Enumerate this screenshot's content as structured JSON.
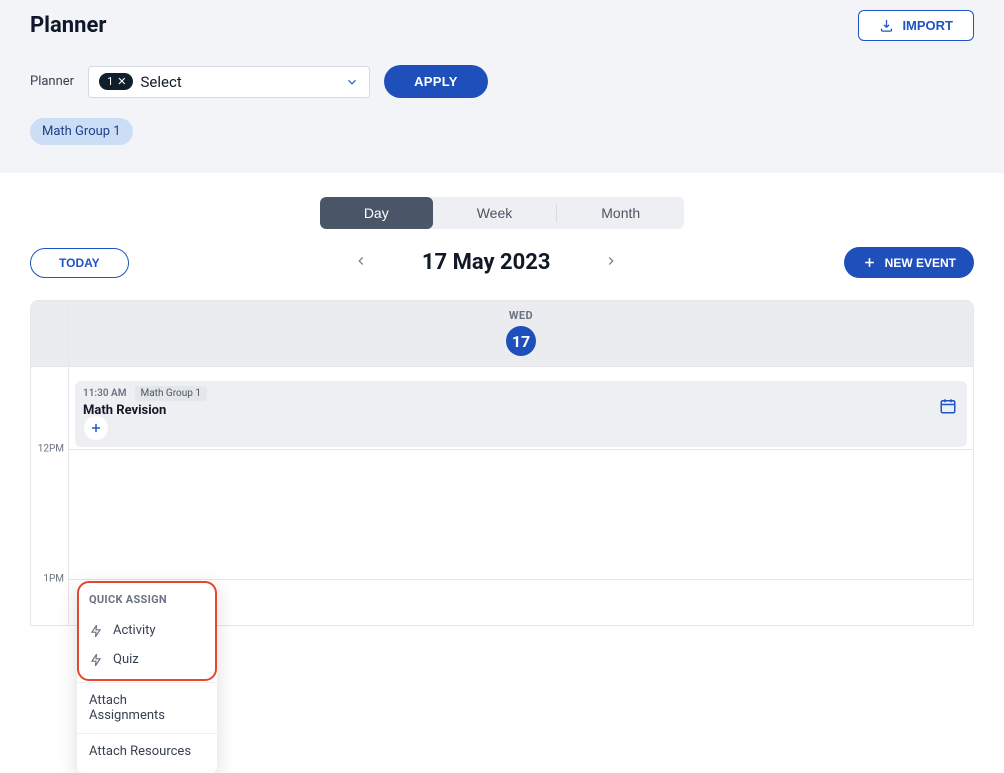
{
  "header": {
    "title": "Planner",
    "import_label": "IMPORT",
    "filter_label": "Planner",
    "select_count": "1",
    "select_placeholder": "Select",
    "apply_label": "APPLY"
  },
  "chips": [
    {
      "label": "Math Group 1"
    }
  ],
  "view_toggle": {
    "day": "Day",
    "week": "Week",
    "month": "Month"
  },
  "nav": {
    "today": "TODAY",
    "date": "17 May 2023",
    "new_event": "NEW EVENT"
  },
  "calendar": {
    "dow": "WED",
    "daynum": "17",
    "times": {
      "t12": "12PM",
      "t1": "1PM"
    },
    "event": {
      "time": "11:30 AM",
      "tag": "Math Group 1",
      "title": "Math Revision"
    }
  },
  "popover": {
    "title": "QUICK ASSIGN",
    "activity": "Activity",
    "quiz": "Quiz",
    "attach_assignments": "Attach Assignments",
    "attach_resources": "Attach Resources"
  }
}
